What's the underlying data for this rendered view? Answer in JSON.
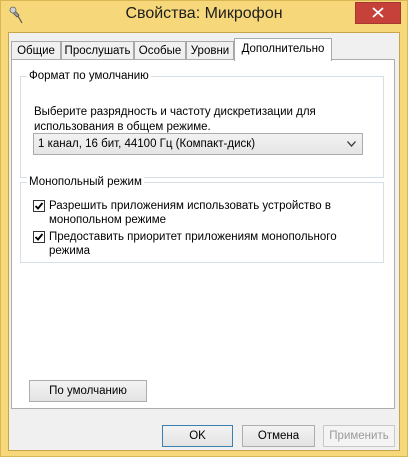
{
  "window": {
    "title": "Свойства: Микрофон",
    "app_icon": "microphone-icon",
    "close_icon": "close-icon"
  },
  "tabs": [
    {
      "label": "Общие",
      "active": false
    },
    {
      "label": "Прослушать",
      "active": false
    },
    {
      "label": "Особые",
      "active": false
    },
    {
      "label": "Уровни",
      "active": false
    },
    {
      "label": "Дополнительно",
      "active": true
    }
  ],
  "default_format": {
    "group_label": "Формат по умолчанию",
    "description_line1": "Выберите разрядность и частоту дискретизации для",
    "description_line2": "использования в общем режиме.",
    "selected": "1 канал, 16 бит, 44100 Гц (Компакт-диск)"
  },
  "exclusive_mode": {
    "group_label": "Монопольный режим",
    "options": [
      {
        "line1": "Разрешить приложениям использовать устройство в",
        "line2": "монопольном режиме",
        "checked": true
      },
      {
        "line1": "Предоставить приоритет приложениям монопольного",
        "line2": "режима",
        "checked": true
      }
    ]
  },
  "buttons": {
    "defaults": "По умолчанию",
    "ok": "OK",
    "cancel": "Отмена",
    "apply": "Применить"
  },
  "colors": {
    "frame": "#f6d77a",
    "close": "#c7413b"
  }
}
